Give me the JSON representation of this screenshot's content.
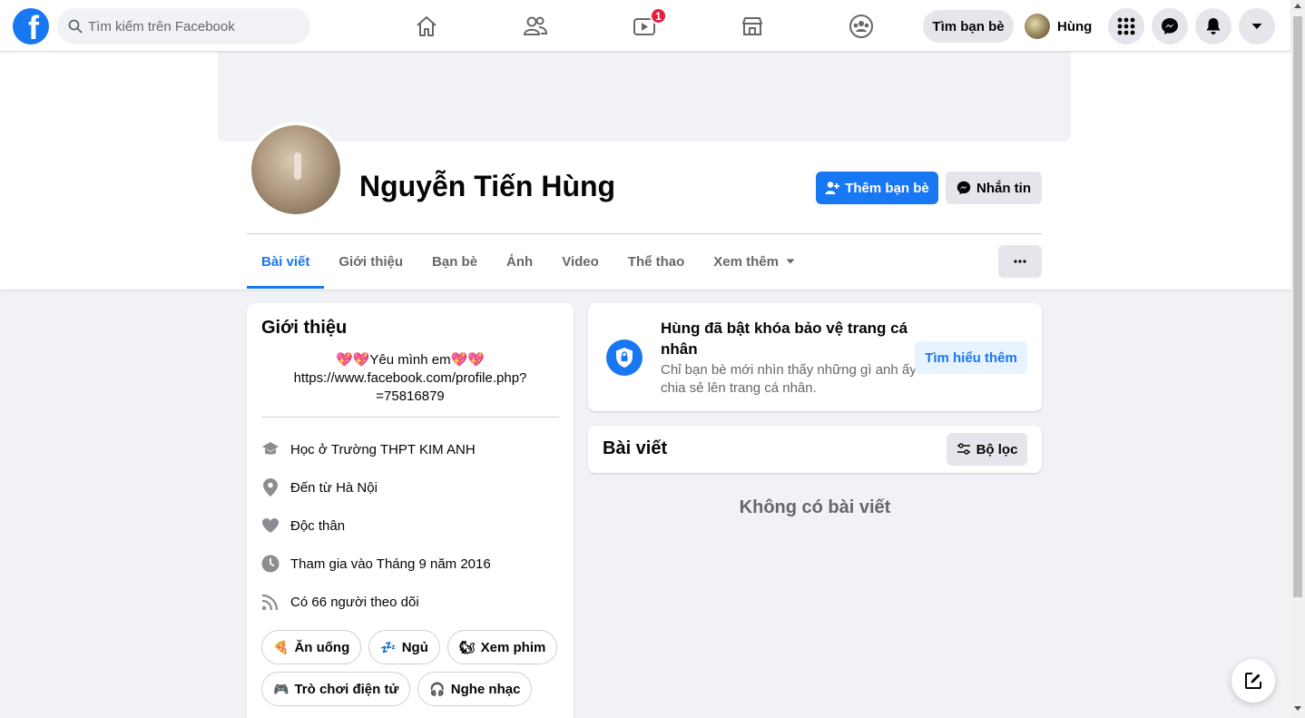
{
  "topbar": {
    "search_placeholder": "Tìm kiếm trên Facebook",
    "watch_badge": "1",
    "find_friends": "Tìm bạn bè",
    "user_name": "Hùng"
  },
  "profile": {
    "name": "Nguyễn Tiến Hùng",
    "add_friend": "Thêm bạn bè",
    "message": "Nhắn tin"
  },
  "tabs": [
    "Bài viết",
    "Giới thiệu",
    "Bạn bè",
    "Ảnh",
    "Video",
    "Thể thao",
    "Xem thêm"
  ],
  "intro": {
    "title": "Giới thiệu",
    "bio_line1": "💖💖Yêu mình em💖💖",
    "bio_line2": "https://www.facebook.com/profile.php?",
    "bio_line3": "=75816879",
    "school_prefix": "Học ở ",
    "school": "Trường THPT KIM ANH",
    "from_prefix": "Đến từ ",
    "from": "Hà Nội",
    "relationship": "Độc thân",
    "joined": "Tham gia vào Tháng 9 năm 2016",
    "followers_prefix": "Có ",
    "followers": "66 người",
    "followers_suffix": " theo dõi",
    "hobbies": [
      {
        "emoji": "🍕",
        "label": "Ăn uống"
      },
      {
        "emoji": "💤",
        "label": "Ngủ"
      },
      {
        "emoji": "🐿",
        "label": "Xem phim"
      },
      {
        "emoji": "🎮",
        "label": "Trò chơi điện tử"
      },
      {
        "emoji": "🎧",
        "label": "Nghe nhạc"
      }
    ]
  },
  "lock": {
    "title": "Hùng đã bật khóa bảo vệ trang cá nhân",
    "description": "Chỉ bạn bè mới nhìn thấy những gì anh ấy chia sẻ lên trang cá nhân.",
    "learn_more": "Tìm hiểu thêm"
  },
  "posts": {
    "title": "Bài viết",
    "filter": "Bộ lọc",
    "empty": "Không có bài viết"
  },
  "colors": {
    "brand": "#1877f2",
    "badge": "#e41e3f",
    "background": "#f0f2f5"
  }
}
